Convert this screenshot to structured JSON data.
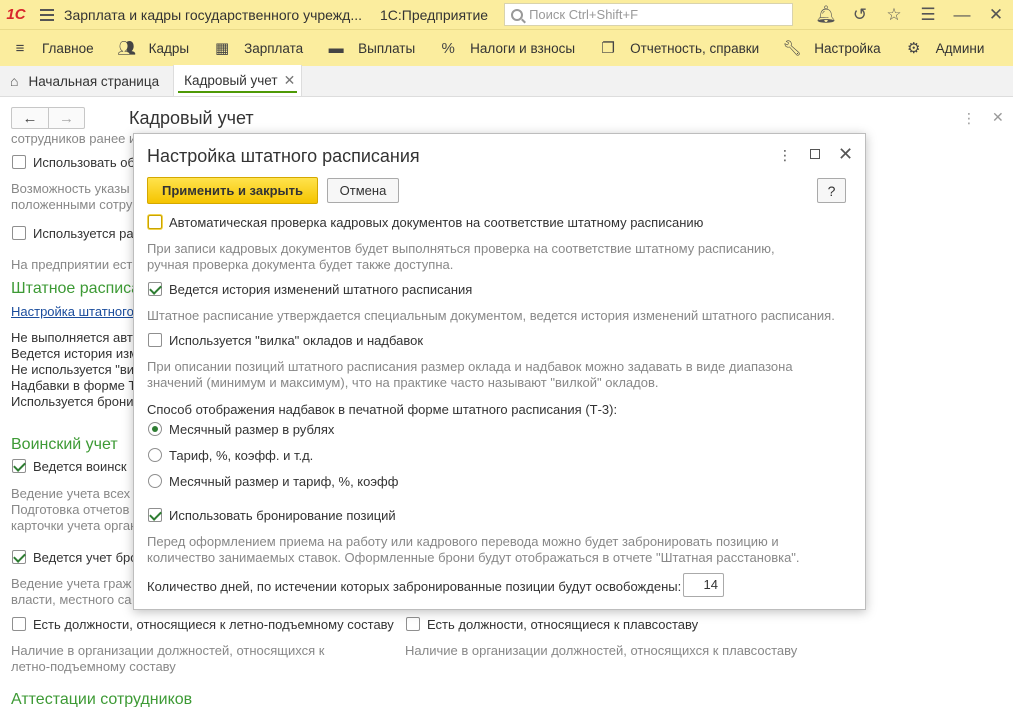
{
  "titlebar": {
    "logo": "1С",
    "title": "Зарплата и кадры государственного учрежд...",
    "platform": "1С:Предприятие",
    "search_placeholder": "Поиск Ctrl+Shift+F"
  },
  "sections": [
    {
      "label": "Главное",
      "icon": "home-icon"
    },
    {
      "label": "Кадры",
      "icon": "people-icon"
    },
    {
      "label": "Зарплата",
      "icon": "calculator-icon"
    },
    {
      "label": "Выплаты",
      "icon": "wallet-icon"
    },
    {
      "label": "Налоги и взносы",
      "icon": "percent-icon"
    },
    {
      "label": "Отчетность, справки",
      "icon": "reports-icon"
    },
    {
      "label": "Настройка",
      "icon": "wrench-icon"
    },
    {
      "label": "Админи",
      "icon": "gear-icon"
    }
  ],
  "tabs": {
    "home": "Начальная страница",
    "active": "Кадровый учет"
  },
  "form": {
    "title": "Кадровый учет",
    "lines": {
      "l0": "сотрудников ранее и",
      "l1": "Использовать об",
      "l2": "Возможность указы",
      "l3": "положенными сотру",
      "l4": "Используется ра",
      "l5": "На предприятии есть",
      "h1": "Штатное расписа",
      "link": "Настройка штатного",
      "s1": "Не выполняется авто",
      "s2": "Ведется история изм",
      "s3": "Не используется \"ви",
      "s4": "Надбавки в форме Т",
      "s5": "Используется брони",
      "h2": "Воинский учет",
      "m1": "Ведется воинск",
      "m2": "Ведение учета всех",
      "m3": "Подготовка отчетов д",
      "m4": "карточки учета орган",
      "m5": "Ведется учет бро",
      "m6": "Ведение учета граж",
      "m7": "власти, местного са",
      "f1": "Есть должности, относящиеся к летно-подъемному составу",
      "f2": "Наличие в организации должностей, относящихся к",
      "f3": "летно-подъемному составу",
      "f4": "Есть должности, относящиеся к плавсоставу",
      "f5": "Наличие в организации должностей, относящихся к плавсоставу",
      "h3": "Аттестации сотрудников"
    }
  },
  "dialog": {
    "title": "Настройка штатного расписания",
    "apply_label": "Применить и закрыть",
    "cancel_label": "Отмена",
    "help_label": "?",
    "opt1_label": "Автоматическая проверка кадровых документов на соответствие штатному расписанию",
    "opt1_desc1": "При записи кадровых документов будет выполняться проверка на соответствие штатному расписанию,",
    "opt1_desc2": "ручная проверка документа будет также доступна.",
    "opt2_label": "Ведется история изменений штатного расписания",
    "opt2_desc": "Штатное расписание утверждается специальным документом, ведется история изменений штатного расписания.",
    "opt3_label": "Используется \"вилка\" окладов и надбавок",
    "opt3_desc1": "При описании позиций штатного расписания размер оклада и надбавок можно задавать в виде диапазона",
    "opt3_desc2": "значений (минимум и максимум), что на практике часто называют \"вилкой\" окладов.",
    "radio_group_label": "Способ отображения надбавок в печатной форме штатного расписания (Т-3):",
    "radio1": "Месячный размер в рублях",
    "radio2": "Тариф, %, коэфф. и т.д.",
    "radio3": "Месячный размер и тариф, %, коэфф",
    "opt4_label": "Использовать бронирование позиций",
    "opt4_desc1": "Перед оформлением приема на работу или кадрового перевода можно будет забронировать позицию и",
    "opt4_desc2": "количество занимаемых ставок. Оформленные брони будут отображаться в отчете \"Штатная расстановка\".",
    "days_label": "Количество дней, по истечении которых забронированные позиции будут освобождены:",
    "days_value": "14"
  },
  "state": {
    "opt1": false,
    "opt2": true,
    "opt3": false,
    "opt4": true,
    "radio_selected": 1
  }
}
